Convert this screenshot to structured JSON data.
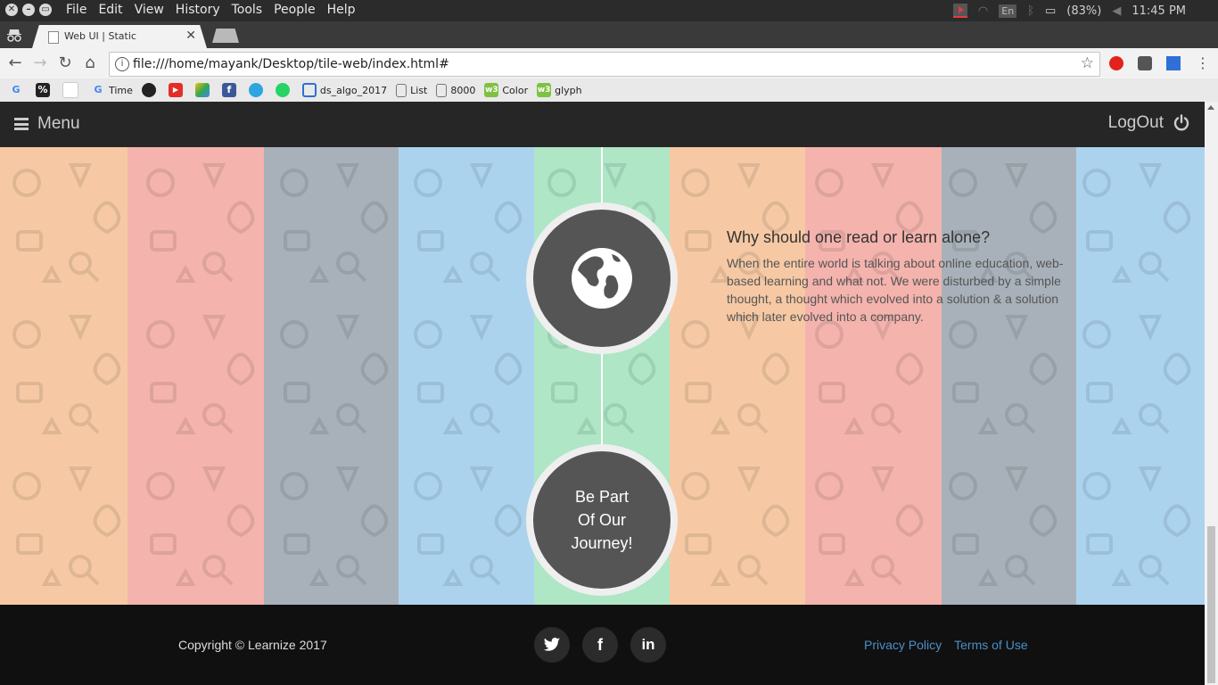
{
  "os": {
    "menus": [
      "File",
      "Edit",
      "View",
      "History",
      "Tools",
      "People",
      "Help"
    ],
    "lang": "En",
    "battery": "(83%)",
    "time": "11:45 PM"
  },
  "browser": {
    "tab_title": "Web UI | Static",
    "url": "file:///home/mayank/Desktop/tile-web/index.html#",
    "bookmarks": {
      "time": "Time",
      "ds_algo": "ds_algo_2017",
      "list": "List",
      "n8000": "8000",
      "color": "Color",
      "glyph": "glyph"
    }
  },
  "navbar": {
    "menu_label": "Menu",
    "logout_label": "LogOut"
  },
  "content": {
    "heading": "Why should one read or learn alone?",
    "body": "When the entire world is talking about online education, web-based learning and what not. We were disturbed by a simple thought, a thought which evolved into a solution & a solution which later evolved into a company.",
    "cta_line1": "Be Part",
    "cta_line2": "Of Our",
    "cta_line3": "Journey!"
  },
  "footer": {
    "copyright": "Copyright © Learnize 2017",
    "privacy": "Privacy Policy",
    "terms": "Terms of Use",
    "social": [
      "twitter-icon",
      "facebook-icon",
      "linkedin-icon"
    ]
  },
  "colors": {
    "peach": "#f6c9a4",
    "pink": "#f4b3ad",
    "gray": "#a8b1b9",
    "blue": "#acd3ee",
    "mint": "#aee6c6",
    "circle": "#555555",
    "link": "#4a8fc7"
  }
}
